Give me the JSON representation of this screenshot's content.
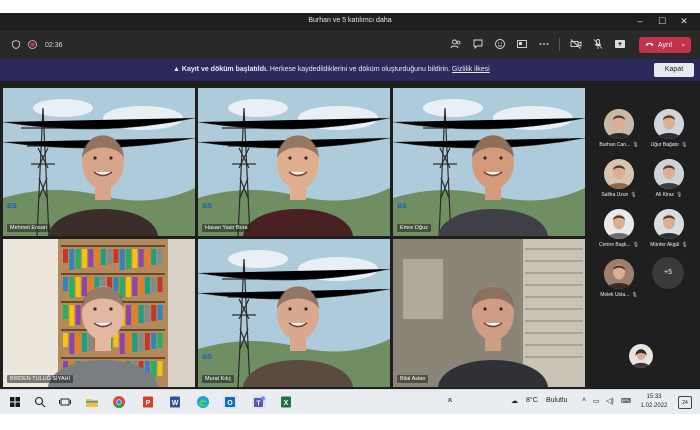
{
  "window": {
    "title": "Burhan ve 5 katılımcı daha"
  },
  "toolbar": {
    "duration": "02:36",
    "leave_label": "Ayrıl"
  },
  "banner": {
    "bold": "Kayıt ve döküm başlatıldı.",
    "text": "Herkese kaydedildiklerini ve döküm oluşturduğunu bildirin.",
    "link": "Gizlilik ilkesi",
    "dismiss": "Kapat"
  },
  "tiles": [
    {
      "name": "Mehmet Ensari"
    },
    {
      "name": "Hasan Yasir Bora"
    },
    {
      "name": "Emre Oğuz"
    },
    {
      "name": "BİRDEN TULUĞ SİYAHİ"
    },
    {
      "name": "Murat Kılıç"
    },
    {
      "name": "Bilal Aslan"
    }
  ],
  "roster": [
    {
      "name": "Burhan Can..."
    },
    {
      "name": "Uğur Bağatır"
    },
    {
      "name": "Saliha Uzun"
    },
    {
      "name": "Ali Kiraz"
    },
    {
      "name": "Cemre Başk..."
    },
    {
      "name": "Münfer Akgül"
    },
    {
      "name": "Melek Usta..."
    }
  ],
  "roster_more": "+5",
  "taskbar": {
    "weather_temp": "8°C",
    "weather_text": "Bulutlu",
    "time": "15:33",
    "date": "1.02.2022",
    "notifications": "24"
  },
  "colors": {
    "accent": "#7b83eb",
    "leave": "#c4314b",
    "banner": "#2b2a5b"
  }
}
